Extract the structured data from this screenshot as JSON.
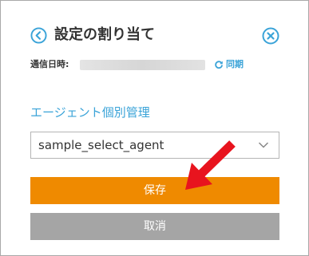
{
  "dialog": {
    "title": "設定の割り当て",
    "back_icon": "chevron-left-circle-icon",
    "close_icon": "close-circle-icon",
    "accent_color": "#3aa3d8"
  },
  "sync": {
    "label": "通信日時:",
    "value_hidden": true,
    "link_label": "同期",
    "link_icon": "refresh-icon"
  },
  "agent": {
    "section_label": "エージェント個別管理",
    "selected_value": "sample_select_agent",
    "chevron_icon": "chevron-down-icon"
  },
  "buttons": {
    "save_label": "保存",
    "save_color": "#ef8a00",
    "cancel_label": "取消",
    "cancel_color": "#a5a5a5"
  },
  "annotation": {
    "arrow_color": "#e8141e",
    "arrow_icon": "pointer-arrow-icon"
  }
}
